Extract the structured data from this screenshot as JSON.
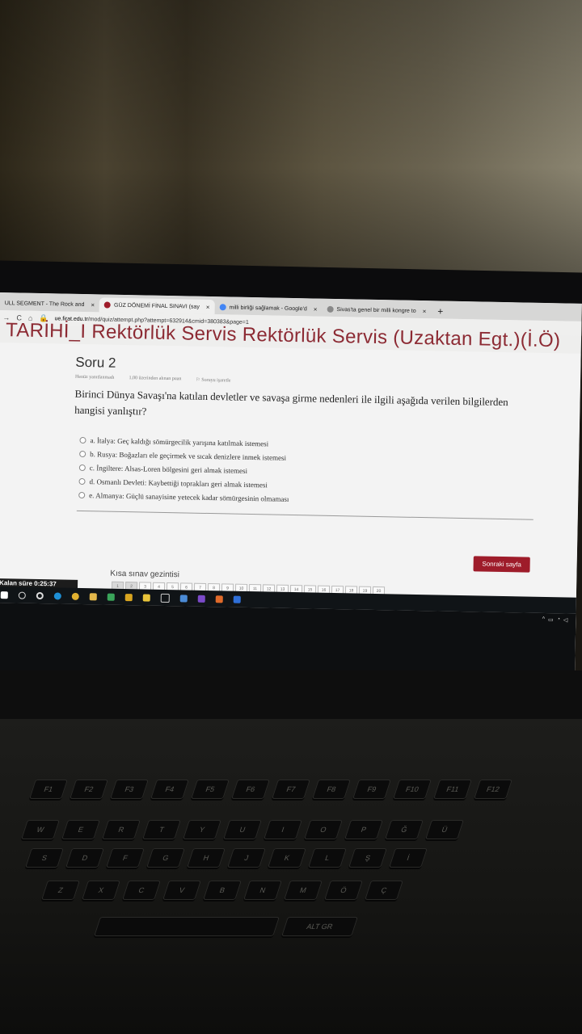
{
  "browser": {
    "tabs": [
      {
        "label": "ULL SEGMENT - The Rock and",
        "close": "×",
        "active": false,
        "icon_color": "#cc0000"
      },
      {
        "label": "GÜZ DÖNEMİ FİNAL SINAVI (say",
        "close": "×",
        "active": true,
        "icon_color": "#9e1c2a"
      },
      {
        "label": "milli birliği sağlamak - Google'd",
        "close": "×",
        "active": false,
        "icon_color": "#4285f4"
      },
      {
        "label": "Sivas'ta genel bir milli kongre to",
        "close": "×",
        "active": false,
        "icon_color": "#888888"
      }
    ],
    "new_tab": "+",
    "back": "→",
    "reload": "C",
    "home": "⌂",
    "url_domain": "ue.firat.edu.tr",
    "url_path": "/mod/quiz/attempt.php?attempt=632914&cmid=380383&page=1"
  },
  "course_title": "TARİHİ_I Rektörlük Servis Rektörlük Servis (Uzaktan Egt.)(İ.Ö)",
  "question": {
    "number": "Soru 2",
    "status": "Henüz yanıtlanmadı",
    "points": "1,00 üzerinden alınan puan",
    "flag": "Soruyu işaretle",
    "text": "Birinci Dünya Savaşı'na katılan devletler ve savaşa girme nedenleri ile ilgili aşağıda verilen bilgilerden hangisi yanlıştır?",
    "options": [
      "a. İtalya: Geç kaldığı sömürgecilik yarışına katılmak istemesi",
      "b. Rusya: Boğazları ele geçirmek ve sıcak denizlere inmek istemesi",
      "c. İngiltere: Alsas-Loren bölgesini geri almak istemesi",
      "d. Osmanlı Devleti: Kaybettiği toprakları geri almak istemesi",
      "e. Almanya: Güçlü sanayisine yetecek kadar sömürgesinin olmaması"
    ]
  },
  "next_button": "Sonraki sayfa",
  "quiz_nav": {
    "title": "Kısa sınav gezintisi",
    "pages": [
      "1",
      "2",
      "3",
      "4",
      "5",
      "6",
      "7",
      "8",
      "9",
      "10",
      "11",
      "12",
      "13",
      "14",
      "15",
      "16",
      "17",
      "18",
      "19",
      "20"
    ]
  },
  "timer": "Kalan süre 0:25:37",
  "keyboard": {
    "row1": [
      "F1",
      "F2",
      "F3",
      "F4",
      "F5",
      "F6",
      "F7",
      "F8",
      "F9",
      "F10",
      "F11",
      "F12"
    ],
    "row2": [
      "W",
      "E",
      "R",
      "T",
      "Y",
      "U",
      "I",
      "O",
      "P",
      "Ğ",
      "Ü"
    ],
    "row3": [
      "S",
      "D",
      "F",
      "G",
      "H",
      "J",
      "K",
      "L",
      "Ş",
      "İ"
    ],
    "row4": [
      "Z",
      "X",
      "C",
      "V",
      "B",
      "N",
      "M",
      "Ö",
      "Ç"
    ],
    "alt_gr": "ALT GR"
  },
  "colors": {
    "accent": "#9e1c2a",
    "title": "#8c2a33"
  }
}
